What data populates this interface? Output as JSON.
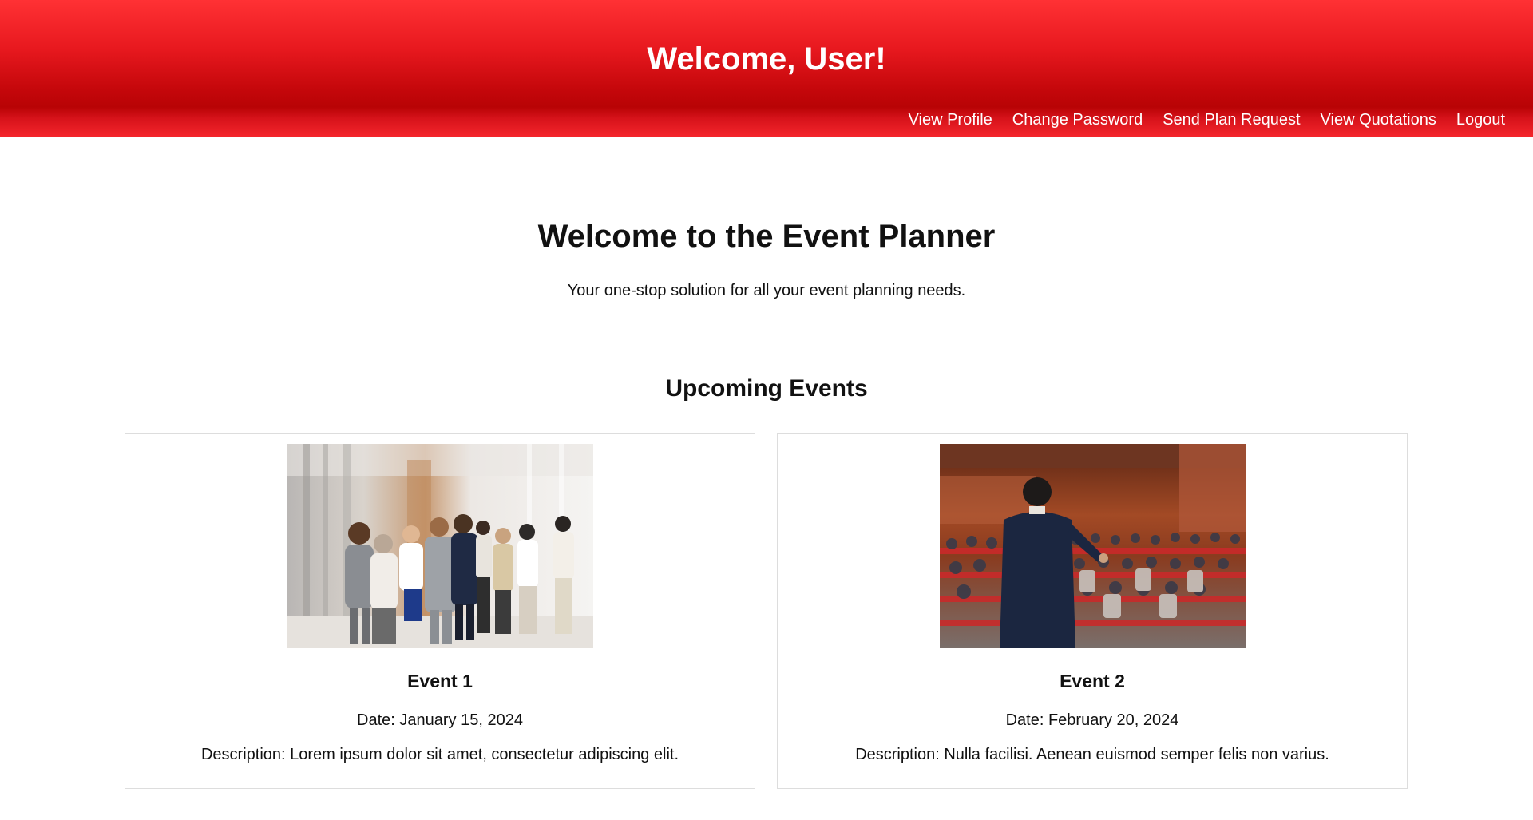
{
  "header": {
    "title": "Welcome, User!",
    "brand_color": "#e8191f",
    "nav": [
      {
        "label": "View Profile"
      },
      {
        "label": "Change Password"
      },
      {
        "label": "Send Plan Request"
      },
      {
        "label": "View Quotations"
      },
      {
        "label": "Logout"
      }
    ]
  },
  "hero": {
    "title": "Welcome to the Event Planner",
    "subtitle": "Your one-stop solution for all your event planning needs."
  },
  "events": {
    "section_title": "Upcoming Events",
    "items": [
      {
        "name": "Event 1",
        "date": "Date: January 15, 2024",
        "description": "Description: Lorem ipsum dolor sit amet, consectetur adipiscing elit.",
        "image_icon": "networking-photo"
      },
      {
        "name": "Event 2",
        "date": "Date: February 20, 2024",
        "description": "Description: Nulla facilisi. Aenean euismod semper felis non varius.",
        "image_icon": "conference-photo"
      }
    ]
  }
}
